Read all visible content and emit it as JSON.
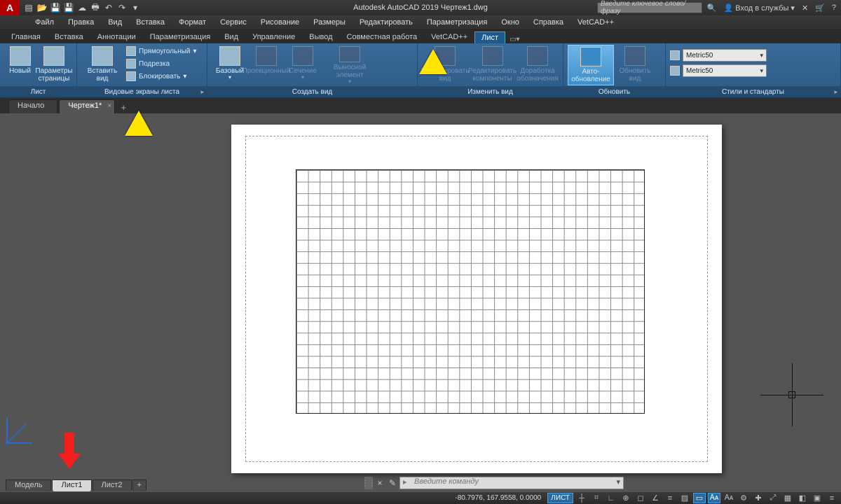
{
  "window": {
    "title": "Autodesk AutoCAD 2019    Чертеж1.dwg"
  },
  "qat_icons": [
    "new-icon",
    "open-icon",
    "save-icon",
    "saveas-icon",
    "plot-icon",
    "undo-icon",
    "redo-icon",
    "print-icon"
  ],
  "title_search": {
    "placeholder": "Введите ключевое слово/фразу"
  },
  "title_right": {
    "login": "Вход в службы"
  },
  "menu": [
    "Файл",
    "Правка",
    "Вид",
    "Вставка",
    "Формат",
    "Сервис",
    "Рисование",
    "Размеры",
    "Редактировать",
    "Параметризация",
    "Окно",
    "Справка",
    "VetCAD++"
  ],
  "ribbon_tabs": [
    "Главная",
    "Вставка",
    "Аннотации",
    "Параметризация",
    "Вид",
    "Управление",
    "Вывод",
    "Совместная работа",
    "VetCAD++",
    "Лист"
  ],
  "ribbon_active": 9,
  "panels": {
    "sheet": {
      "label": "Лист",
      "new": "Новый",
      "page": "Параметры\nстраницы"
    },
    "vports": {
      "label": "Видовые экраны листа",
      "insert": "Вставить вид",
      "rect": "Прямоугольный",
      "clip": "Подрезка",
      "lock": "Блокировать"
    },
    "create": {
      "label": "Создать вид",
      "base": "Базовый",
      "proj": "Проекционный",
      "section": "Сечение",
      "detail": "Выносной элемент"
    },
    "modify": {
      "label": "Изменить вид",
      "edit": "Редактировать вид",
      "editcomp": "Редактировать компоненты",
      "symupd": "Доработка обозначения"
    },
    "update": {
      "label": "Обновить",
      "auto": "Авто-\nобновление",
      "upd": "Обновить\nвид"
    },
    "styles": {
      "label": "Стили и стандарты",
      "v1": "Metric50",
      "v2": "Metric50"
    }
  },
  "doc_tabs": [
    {
      "label": "Начало",
      "active": false
    },
    {
      "label": "Чертеж1*",
      "active": true
    }
  ],
  "layout_tabs": [
    {
      "label": "Модель",
      "active": false
    },
    {
      "label": "Лист1",
      "active": true
    },
    {
      "label": "Лист2",
      "active": false
    }
  ],
  "command": {
    "placeholder": "Введите  команду"
  },
  "status": {
    "coords": "-80.7976, 167.9558, 0.0000",
    "mode": "ЛИСТ"
  }
}
